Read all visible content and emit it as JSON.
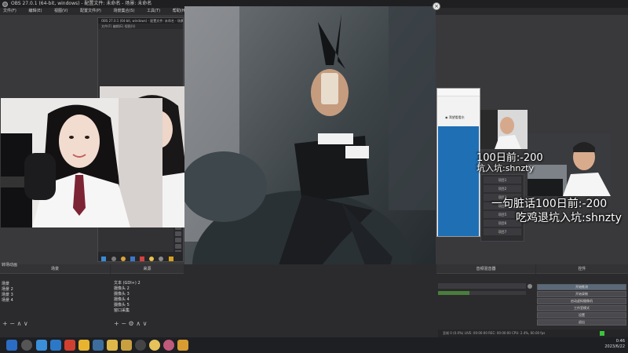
{
  "window": {
    "title": "OBS 27.0.1 (64-bit, windows) - 配置文件: 未命名 - 场景: 未命名"
  },
  "menubar": [
    "文件(F)",
    "编辑(E)",
    "视图(V)",
    "配置文件(P)",
    "场景集合(S)",
    "工具(T)",
    "帮助(H)"
  ],
  "overlay": {
    "line1": "一句脏话100日前:-200",
    "line2": "吃鸡退坑入坑:shnzty",
    "small_line1": "100日前:-200",
    "small_line2": "坑入坑:shnzty"
  },
  "side_window": {
    "button": "渴望看看东"
  },
  "side_list": [
    "项目1",
    "项目2",
    "项目3",
    "项目4",
    "项目5",
    "项目6",
    "项目7"
  ],
  "docks": {
    "scenes_header": "场景",
    "sources_header": "来源",
    "mixer_header": "音频混音器",
    "controls_header": "控件",
    "transitions_header": "转场动画",
    "scenes": [
      "场景",
      "场景 2",
      "场景 3",
      "场景 4"
    ],
    "sources": [
      "文本 (GDI+) 2",
      "摄像头 2",
      "摄像头 3",
      "摄像头 4",
      "摄像头 5",
      "窗口采集"
    ],
    "scene_toolbar": [
      "+",
      "−",
      "∧",
      "∨"
    ],
    "source_toolbar": [
      "+",
      "−",
      "⚙",
      "∧",
      "∨"
    ]
  },
  "controls": [
    "开始推流",
    "开始录制",
    "启动虚拟摄像机",
    "工作室模式",
    "设置",
    "退出"
  ],
  "status": {
    "text": "丢帧 0 (0.0%)   LIVE: 00:00:00   REC: 00:00:00   CPU: 2.4%, 60.00 fps"
  },
  "taskbar": {
    "time": "0:46",
    "date": "2023/6/22"
  },
  "colors": {
    "obs_bg": "#3a3a3d",
    "dock_bg": "#2b2b2e",
    "taskbar_bg": "#1d1f23",
    "overlay_text": "#ffffff"
  }
}
